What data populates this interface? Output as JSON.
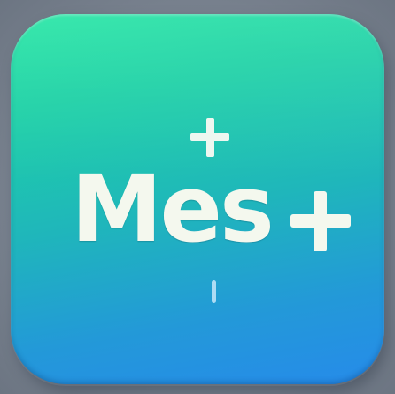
{
  "app_icon": {
    "wordmark": "Mes",
    "icons": {
      "top_symbol": "plus-icon",
      "trailing_symbol": "plus-icon",
      "bottom_mark": "line-mark-icon"
    },
    "colors": {
      "gradient_top": "#22e6a2",
      "gradient_bottom": "#268bea",
      "glyph": "#f4f8ee",
      "background": "#7d8794"
    }
  }
}
